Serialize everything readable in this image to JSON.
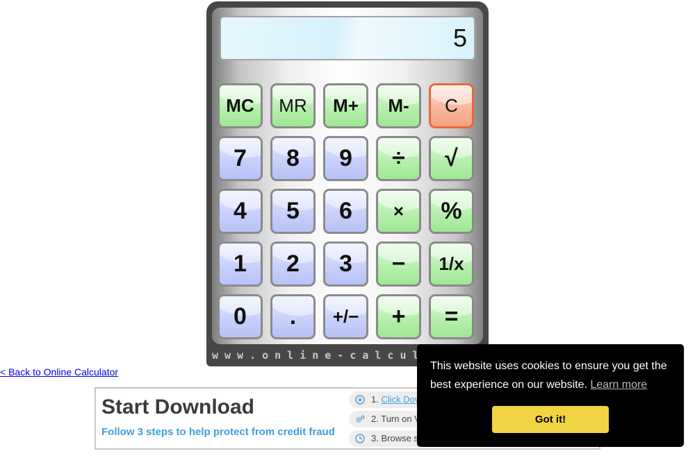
{
  "calculator": {
    "display_value": "5",
    "brand_text": "www.online-calculator.com",
    "keys": {
      "mc": "MC",
      "mr": "MR",
      "m_plus": "M+",
      "m_minus": "M-",
      "c": "C",
      "seven": "7",
      "eight": "8",
      "nine": "9",
      "divide": "÷",
      "sqrt": "√",
      "four": "4",
      "five": "5",
      "six": "6",
      "multiply": "×",
      "percent": "%",
      "one": "1",
      "two": "2",
      "three": "3",
      "minus": "−",
      "reciprocal": "1/x",
      "zero": "0",
      "decimal": ".",
      "plus_minus": "+/−",
      "plus": "+",
      "equals": "="
    }
  },
  "back_link": "< Back to Online Calculator",
  "ad": {
    "title": "Start Download",
    "subtitle": "Follow 3 steps to help protect from credit fraud",
    "steps": [
      {
        "number": "1.",
        "text": "Click Dov",
        "icon": "download-circle-icon"
      },
      {
        "number": "2.",
        "text": "Turn on V",
        "icon": "gears-icon"
      },
      {
        "number": "3.",
        "text": "Browse s",
        "icon": "clock-icon"
      }
    ]
  },
  "cookie_notice": {
    "message": "This website uses cookies to ensure you get the best experience on our website.",
    "learn_more": "Learn more",
    "button": "Got it!",
    "button_color": "#f1d444"
  }
}
